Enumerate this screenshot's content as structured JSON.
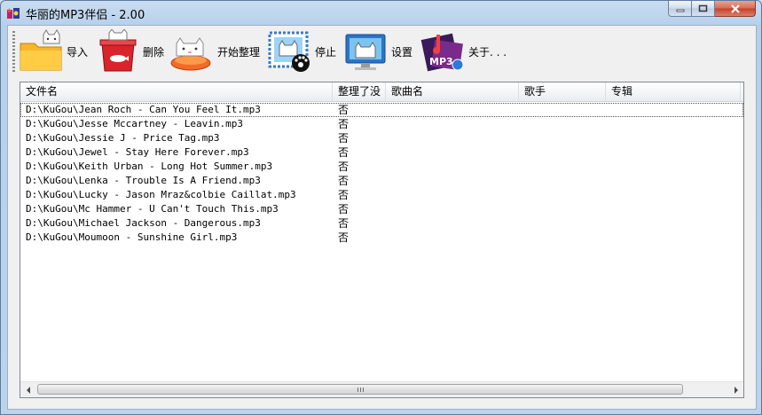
{
  "window": {
    "title": "华丽的MP3伴侣 - 2.00"
  },
  "toolbar": [
    {
      "id": "import",
      "label": "导入",
      "icon": "folder-cat-icon"
    },
    {
      "id": "delete",
      "label": "删除",
      "icon": "trash-cat-icon"
    },
    {
      "id": "start",
      "label": "开始整理",
      "icon": "cat-cushion-icon"
    },
    {
      "id": "stop",
      "label": "停止",
      "icon": "stop-stamp-icon"
    },
    {
      "id": "settings",
      "label": "设置",
      "icon": "monitor-cat-icon"
    },
    {
      "id": "about",
      "label": "关于. . .",
      "icon": "mp3-music-icon"
    }
  ],
  "list": {
    "columns": [
      "文件名",
      "整理了没",
      "歌曲名",
      "歌手",
      "专辑"
    ],
    "rows": [
      {
        "file": "D:\\KuGou\\Jean Roch - Can You Feel It.mp3",
        "status": "否"
      },
      {
        "file": "D:\\KuGou\\Jesse Mccartney - Leavin.mp3",
        "status": "否"
      },
      {
        "file": "D:\\KuGou\\Jessie J - Price Tag.mp3",
        "status": "否"
      },
      {
        "file": "D:\\KuGou\\Jewel - Stay Here Forever.mp3",
        "status": "否"
      },
      {
        "file": "D:\\KuGou\\Keith Urban - Long Hot Summer.mp3",
        "status": "否"
      },
      {
        "file": "D:\\KuGou\\Lenka - Trouble Is A Friend.mp3",
        "status": "否"
      },
      {
        "file": "D:\\KuGou\\Lucky - Jason Mraz&colbie Caillat.mp3",
        "status": "否"
      },
      {
        "file": "D:\\KuGou\\Mc Hammer - U Can't Touch This.mp3",
        "status": "否"
      },
      {
        "file": "D:\\KuGou\\Michael Jackson - Dangerous.mp3",
        "status": "否"
      },
      {
        "file": "D:\\KuGou\\Moumoon - Sunshine Girl.mp3",
        "status": "否"
      }
    ]
  },
  "colors": {
    "window_frame": "#b9d1ea",
    "close_button": "#c4412a",
    "list_bg": "#ffffff"
  }
}
